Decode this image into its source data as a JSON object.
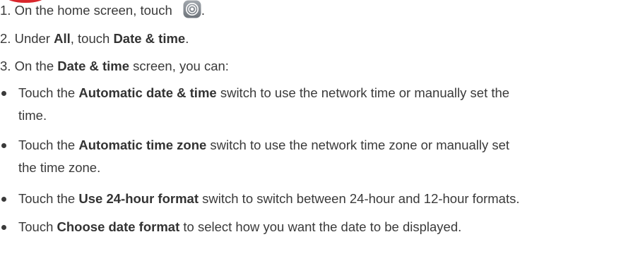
{
  "step1": {
    "number": "1.",
    "text_before": "On the home screen, touch",
    "text_after": "."
  },
  "step2": {
    "number": "2.",
    "t1": "Under ",
    "b1": "All",
    "t2": ", touch ",
    "b2": "Date & time",
    "t3": "."
  },
  "step3": {
    "number": "3.",
    "t1": "On the ",
    "b1": "Date & time",
    "t2": " screen, you can:"
  },
  "bullets": [
    {
      "t1": "Touch the ",
      "b1": "Automatic date & time",
      "t2": " switch to use the network time or manually set the",
      "cont": "time."
    },
    {
      "t1": "Touch the ",
      "b1": "Automatic time zone",
      "t2": " switch to use the network time zone or manually set",
      "cont": "the time zone."
    },
    {
      "t1": "Touch the ",
      "b1": "Use 24-hour format",
      "t2": " switch to switch between 24-hour and 12-hour formats."
    },
    {
      "t1": "Touch ",
      "b1": "Choose date format",
      "t2": " to select how you want the date to be displayed."
    }
  ],
  "icons": {
    "settings": "settings-gear-icon"
  },
  "colors": {
    "text": "#3a3a3a",
    "accent": "#d9262c",
    "icon_gray": "#8a8f96"
  }
}
